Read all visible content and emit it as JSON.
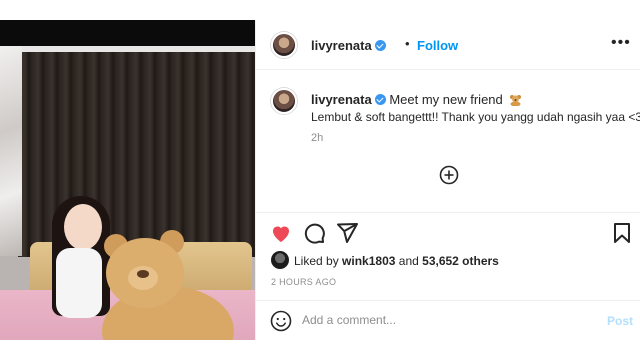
{
  "post": {
    "username": "livyrenata",
    "follow_label": "Follow",
    "separator": "•",
    "more_label": "•••",
    "caption_line1": "Meet my new friend",
    "caption_line2": "Lembut & soft bangettt!! Thank you yangg udah ngasih yaa <3",
    "caption_time": "2h",
    "liked_by_prefix": "Liked by",
    "liked_by_user": "wink1803",
    "liked_by_and": "and",
    "liked_by_others": "53,652 others",
    "posted_ago": "2 HOURS AGO",
    "comment_placeholder": "Add a comment...",
    "post_label": "Post"
  },
  "icons": {
    "verified": "verified-badge-icon",
    "like": "heart-icon",
    "comment": "comment-icon",
    "share": "share-icon",
    "save": "bookmark-icon",
    "more": "more-icon",
    "load_more": "plus-circle-icon",
    "emoji": "smiley-icon",
    "bear": "teddy-bear-emoji"
  },
  "colors": {
    "link": "#0095f6",
    "like_red": "#ed4956",
    "post_disabled": "#b2dffc",
    "muted": "#8e8e8e",
    "text": "#262626"
  }
}
